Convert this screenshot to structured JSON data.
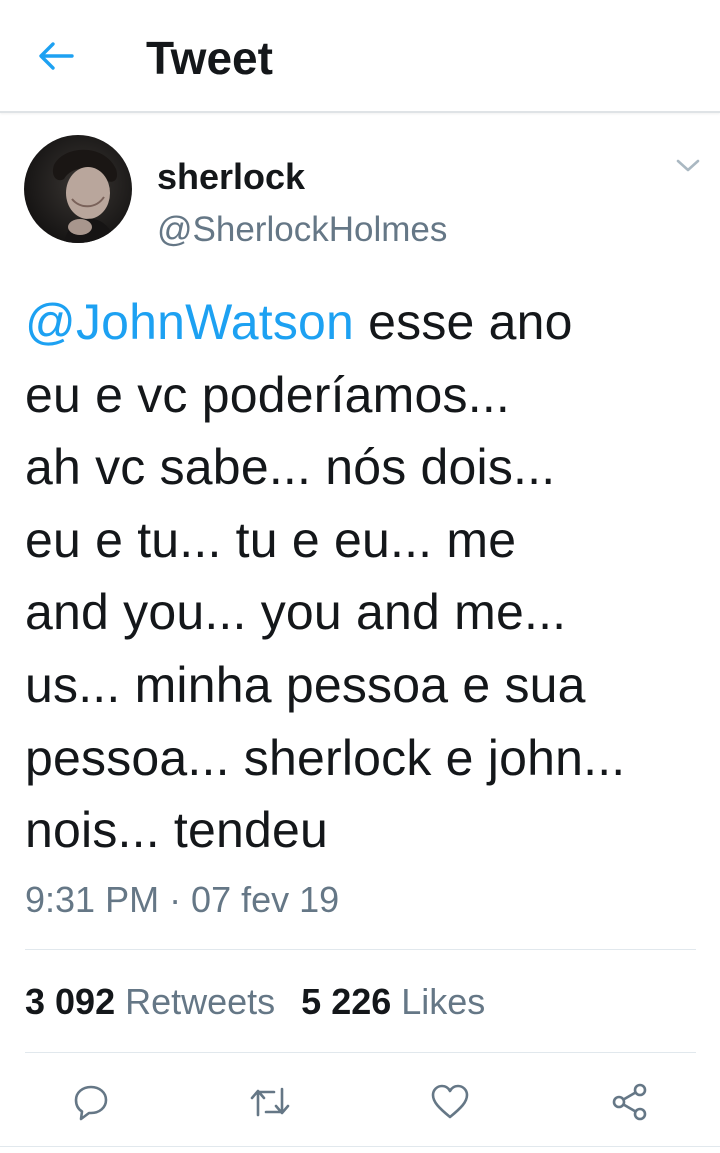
{
  "header": {
    "title": "Tweet",
    "back_icon": "arrow-left-icon",
    "accent": "#1da1f2"
  },
  "author": {
    "display_name": "sherlock",
    "handle": "@SherlockHolmes",
    "avatar_icon": "profile-photo"
  },
  "tweet": {
    "mention": "@JohnWatson",
    "body": " esse ano\neu e vc poderíamos...\nah vc sabe... nós dois...\neu e tu... tu e eu... me\nand you... you and me...\nus... minha pessoa e sua\npessoa... sherlock e john...\nnois... tendeu",
    "timestamp": "9:31 PM · 07 fev 19"
  },
  "stats": {
    "retweets_count": "3 092",
    "retweets_label": "Retweets",
    "likes_count": "5 226",
    "likes_label": "Likes"
  },
  "actions": {
    "reply": "reply-icon",
    "retweet": "retweet-icon",
    "like": "heart-icon",
    "share": "share-icon"
  },
  "colors": {
    "text": "#14171a",
    "secondary": "#657786",
    "link": "#1da1f2",
    "divider": "#e1e8ed"
  }
}
